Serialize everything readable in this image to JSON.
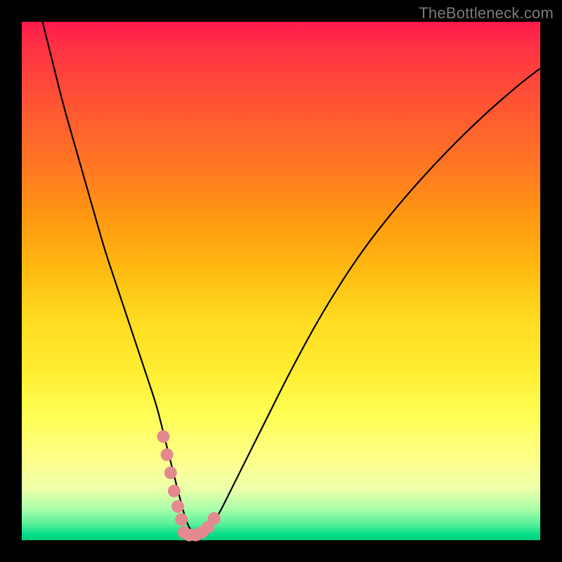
{
  "watermark": "TheBottleneck.com",
  "chart_data": {
    "type": "line",
    "title": "",
    "xlabel": "",
    "ylabel": "",
    "ylim": [
      0,
      100
    ],
    "xlim": [
      0,
      100
    ],
    "series": [
      {
        "name": "curve",
        "x": [
          4,
          6,
          8,
          10,
          12,
          14,
          16,
          18,
          20,
          22,
          24,
          26,
          27,
          28,
          29,
          30,
          30.8,
          31.6,
          32.5,
          33.5,
          34.5,
          36,
          38,
          40,
          43,
          47,
          52,
          58,
          65,
          72,
          80,
          88,
          96,
          100
        ],
        "values": [
          100,
          92,
          84,
          77,
          70,
          63,
          56,
          50,
          44,
          38,
          32,
          26,
          22,
          18,
          14,
          10,
          7,
          4,
          2,
          1,
          1,
          2,
          5,
          9,
          15,
          23,
          33,
          44,
          55,
          64,
          73,
          81,
          88,
          91
        ]
      }
    ],
    "highlighted_segments": [
      {
        "name": "left-slope",
        "x": [
          27.3,
          28.0,
          28.7,
          29.4,
          30.1,
          30.8
        ],
        "values": [
          20,
          16.5,
          13,
          9.5,
          6.5,
          4
        ]
      },
      {
        "name": "bottom",
        "x": [
          31.3,
          32.3,
          33.5,
          34.7,
          35.9,
          37.1
        ],
        "values": [
          1.5,
          1.0,
          1.0,
          1.5,
          2.5,
          4.2
        ]
      }
    ],
    "highlight_color": "#e4898d",
    "curve_color": "#000000"
  }
}
